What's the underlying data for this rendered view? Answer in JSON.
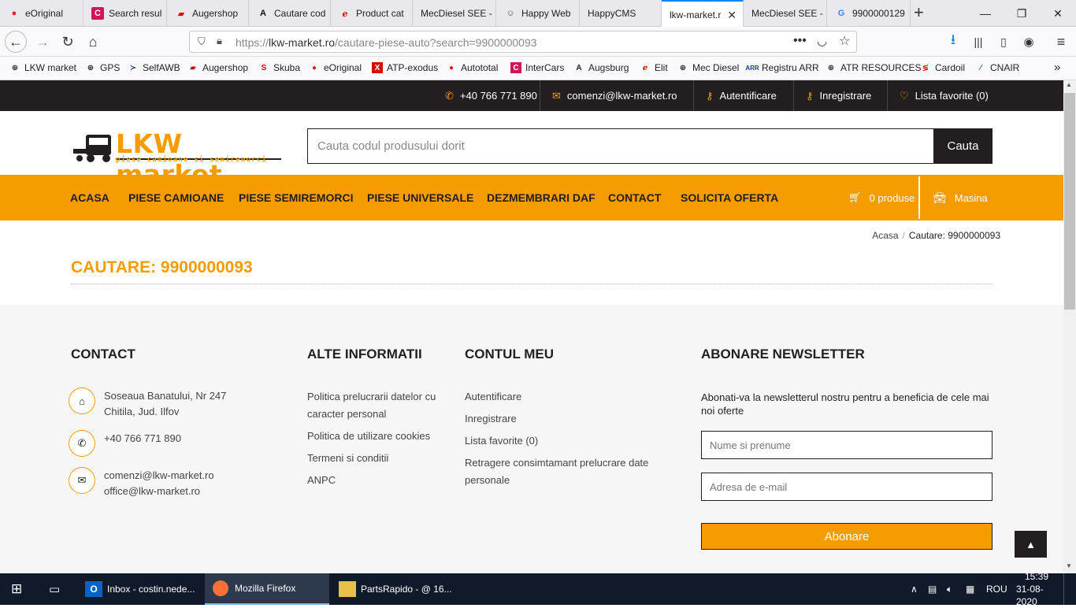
{
  "browser": {
    "tabs": [
      {
        "label": "eOriginal",
        "icon": "eoriginal-icon",
        "color": "#e31e24"
      },
      {
        "label": "Search resul",
        "icon": "search-results-icon",
        "color": "#d4145a"
      },
      {
        "label": "Augershop",
        "icon": "augershop-icon",
        "color": "#d00"
      },
      {
        "label": "Cautare cod",
        "icon": "augsburg-icon",
        "color": "#111"
      },
      {
        "label": "Product cat",
        "icon": "elit-icon",
        "color": "#d00"
      },
      {
        "label": "MecDiesel SEE -",
        "icon": "",
        "color": ""
      },
      {
        "label": "Happy Web",
        "icon": "happy-icon",
        "color": "#555"
      },
      {
        "label": "HappyCMS",
        "icon": "",
        "color": ""
      },
      {
        "label": "lkw-market.r",
        "icon": "",
        "color": ""
      },
      {
        "label": "MecDiesel SEE -",
        "icon": "",
        "color": ""
      },
      {
        "label": "9900000129",
        "icon": "google-icon",
        "color": "#4285f4"
      }
    ],
    "url_prefix": "https://",
    "url_domain": "lkw-market.ro",
    "url_path": "/cautare-piese-auto?search=9900000093",
    "bookmarks": [
      {
        "label": "LKW market",
        "icon": "globe-icon"
      },
      {
        "label": "GPS",
        "icon": "globe-icon"
      },
      {
        "label": "SelfAWB",
        "icon": "selfawb-icon"
      },
      {
        "label": "Augershop",
        "icon": "augershop-icon"
      },
      {
        "label": "Skuba",
        "icon": "skuba-icon"
      },
      {
        "label": "eOriginal",
        "icon": "eoriginal-icon"
      },
      {
        "label": "ATP-exodus",
        "icon": "atp-icon"
      },
      {
        "label": "Autototal",
        "icon": "autototal-icon"
      },
      {
        "label": "InterCars",
        "icon": "intercars-icon"
      },
      {
        "label": "Augsburg",
        "icon": "augsburg-icon"
      },
      {
        "label": "Elit",
        "icon": "elit-icon"
      },
      {
        "label": "Mec Diesel",
        "icon": "globe-icon"
      },
      {
        "label": "Registru ARR",
        "icon": "arr-icon"
      },
      {
        "label": "ATR RESOURCES",
        "icon": "globe-icon"
      },
      {
        "label": "Cardoil",
        "icon": "cardoil-icon"
      },
      {
        "label": "CNAIR",
        "icon": "cnair-icon"
      }
    ]
  },
  "topbar": {
    "phone": "+40 766 771 890",
    "email": "comenzi@lkw-market.ro",
    "login": "Autentificare",
    "register": "Inregistrare",
    "favorites": "Lista favorite (0)"
  },
  "header": {
    "logo_title": "LKW market",
    "logo_subtitle": "piese camioane si semiremorci",
    "search_placeholder": "Cauta codul produsului dorit",
    "search_button": "Cauta"
  },
  "menu": {
    "items": [
      "ACASA",
      "PIESE CAMIOANE",
      "PIESE SEMIREMORCI",
      "PIESE UNIVERSALE",
      "DEZMEMBRARI DAF",
      "CONTACT",
      "SOLICITA OFERTA"
    ],
    "cart": "0 produse",
    "car": "Masina"
  },
  "breadcrumb": {
    "home": "Acasa",
    "current": "Cautare: 9900000093"
  },
  "page_title": "CAUTARE: 9900000093",
  "footer": {
    "contact": {
      "title": "CONTACT",
      "address_line1": "Soseaua Banatului, Nr 247",
      "address_line2": "Chitila, Jud. Ilfov",
      "phone": "+40 766 771 890",
      "email1": "comenzi@lkw-market.ro",
      "email2": "office@lkw-market.ro"
    },
    "info": {
      "title": "ALTE INFORMATII",
      "links": [
        "Politica prelucrarii datelor cu caracter personal",
        "Politica de utilizare cookies",
        "Termeni si conditii",
        "ANPC"
      ]
    },
    "account": {
      "title": "CONTUL MEU",
      "links": [
        "Autentificare",
        "Inregistrare",
        "Lista favorite (0)",
        "Retragere consimtamant prelucrare date personale"
      ]
    },
    "newsletter": {
      "title": "ABONARE NEWSLETTER",
      "text": "Abonati-va la newsletterul nostru pentru a beneficia de cele mai noi oferte",
      "name_placeholder": "Nume si prenume",
      "email_placeholder": "Adresa de e-mail",
      "button": "Abonare"
    }
  },
  "taskbar": {
    "items": [
      "Inbox - costin.nede...",
      "Mozilla Firefox",
      "PartsRapido - @ 16..."
    ],
    "lang": "ROU",
    "time": "15:39",
    "date": "31-08-2020"
  },
  "colors": {
    "accent": "#f59c00",
    "dark": "#231f20",
    "footer_bg": "#f6f6f6"
  }
}
